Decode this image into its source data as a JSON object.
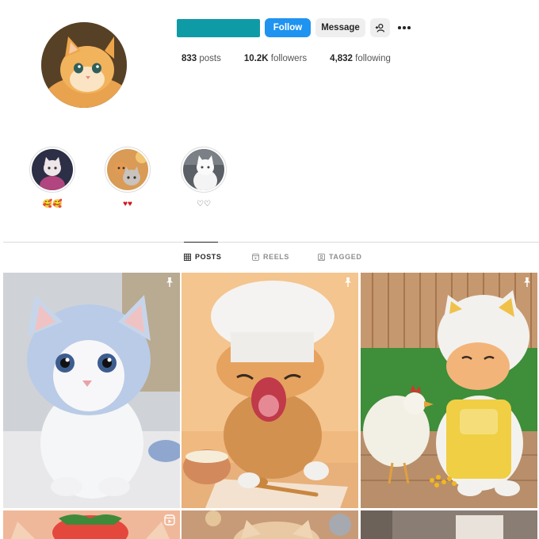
{
  "profile": {
    "follow_label": "Follow",
    "message_label": "Message",
    "stats": {
      "posts_count": "833",
      "posts_label": "posts",
      "followers_count": "10.2K",
      "followers_label": "followers",
      "following_count": "4,832",
      "following_label": "following"
    }
  },
  "highlights": [
    {
      "label": "🥰🥰"
    },
    {
      "label": "♥♥"
    },
    {
      "label": "♡♡"
    }
  ],
  "tabs": [
    {
      "label": "POSTS",
      "icon": "grid-icon"
    },
    {
      "label": "REELS",
      "icon": "reels-icon"
    },
    {
      "label": "TAGGED",
      "icon": "tagged-icon"
    }
  ],
  "colors": {
    "follow_button": "#1f93f0",
    "username_redaction": "#0f9ba6",
    "secondary_button": "#efefef",
    "hearts": "#d0161d"
  }
}
